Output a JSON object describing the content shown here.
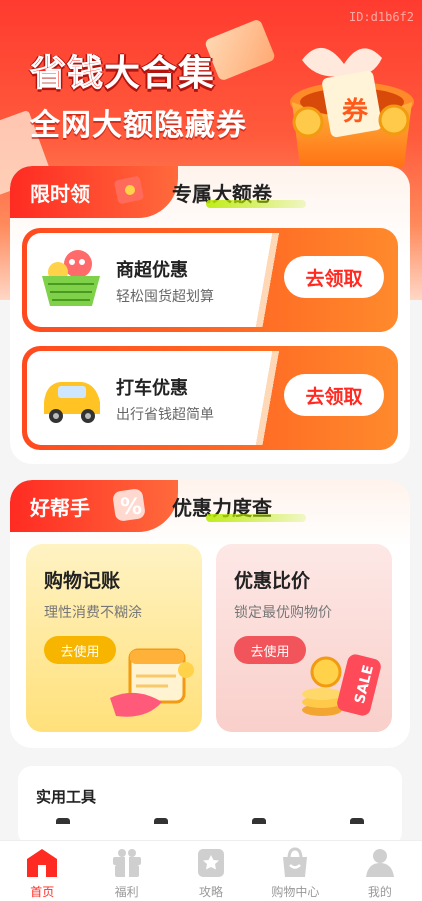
{
  "watermark": "ID:d1b6f2",
  "hero": {
    "title_hot": "省钱",
    "title_rest": "大合集",
    "subtitle": "全网大额隐藏券",
    "coupon_char": "券"
  },
  "section1": {
    "tab_left": "限时领",
    "tab_right": "专属大额卷",
    "offers": [
      {
        "name": "商超优惠",
        "desc": "轻松囤货超划算",
        "cta": "去领取"
      },
      {
        "name": "打车优惠",
        "desc": "出行省钱超简单",
        "cta": "去领取"
      }
    ]
  },
  "section2": {
    "tab_left": "好帮手",
    "tab_right": "优惠力度查",
    "tiles": [
      {
        "title": "购物记账",
        "desc": "理性消费不糊涂",
        "btn": "去使用"
      },
      {
        "title": "优惠比价",
        "desc": "锁定最优购物价",
        "btn": "去使用",
        "tag": "SALE"
      }
    ]
  },
  "tools": {
    "title": "实用工具"
  },
  "tabbar": [
    {
      "label": "首页",
      "icon": "home-icon",
      "active": true
    },
    {
      "label": "福利",
      "icon": "gift-icon",
      "active": false
    },
    {
      "label": "攻略",
      "icon": "guide-icon",
      "active": false
    },
    {
      "label": "购物中心",
      "icon": "shopping-bag-icon",
      "active": false
    },
    {
      "label": "我的",
      "icon": "user-icon",
      "active": false
    }
  ],
  "colors": {
    "brand": "#ff2b22",
    "accent_orange": "#ff6a24",
    "yellow": "#f7b500",
    "pink": "#f2545b"
  }
}
